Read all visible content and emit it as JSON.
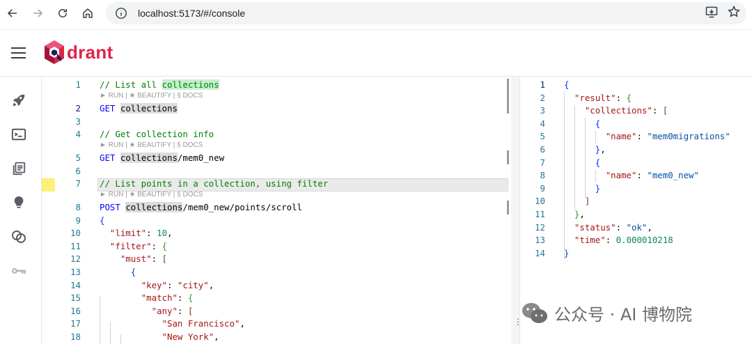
{
  "browser": {
    "url": "localhost:5173/#/console"
  },
  "app": {
    "logo_text": "drant"
  },
  "sidebar": {
    "items": [
      {
        "icon": "rocket-icon"
      },
      {
        "icon": "console-icon"
      },
      {
        "icon": "collections-icon"
      },
      {
        "icon": "lightbulb-icon"
      },
      {
        "icon": "integrations-icon"
      },
      {
        "icon": "key-icon"
      }
    ]
  },
  "editor": {
    "lens_text": "► RUN | ★ BEAUTIFY | § DOCS",
    "lines": [
      {
        "n": "1"
      },
      {
        "n": "2"
      },
      {
        "n": "3"
      },
      {
        "n": "4"
      },
      {
        "n": "5"
      },
      {
        "n": "6"
      },
      {
        "n": "7"
      },
      {
        "n": "8"
      },
      {
        "n": "9"
      },
      {
        "n": "10"
      },
      {
        "n": "11"
      },
      {
        "n": "12"
      },
      {
        "n": "13"
      },
      {
        "n": "14"
      },
      {
        "n": "15"
      },
      {
        "n": "16"
      },
      {
        "n": "17"
      },
      {
        "n": "18"
      }
    ],
    "code": {
      "l1_comment": "// List all ",
      "l1_hl": "collections",
      "l2_method": "GET",
      "l2_path": "collections",
      "l4_comment": "// Get collection info",
      "l5_method": "GET",
      "l5_hl": "collections",
      "l5_rest": "/mem0_new",
      "l7_comment": "// List points in a collection, using filter",
      "l8_method": "POST",
      "l8_hl": "collections",
      "l8_rest": "/mem0_new/points/scroll",
      "l9": "{",
      "l10_key": "\"limit\"",
      "l10_val": "10",
      "l11_key": "\"filter\"",
      "l11_br": "{",
      "l12_key": "\"must\"",
      "l12_br": "[",
      "l13_br": "{",
      "l14_key": "\"key\"",
      "l14_val": "\"city\"",
      "l15_key": "\"match\"",
      "l15_br": "{",
      "l16_key": "\"any\"",
      "l16_br": "[",
      "l17_val": "\"San Francisco\"",
      "l18_val": "\"New York\""
    }
  },
  "result": {
    "lines": [
      {
        "n": "1"
      },
      {
        "n": "2"
      },
      {
        "n": "3"
      },
      {
        "n": "4"
      },
      {
        "n": "5"
      },
      {
        "n": "6"
      },
      {
        "n": "7"
      },
      {
        "n": "8"
      },
      {
        "n": "9"
      },
      {
        "n": "10"
      },
      {
        "n": "11"
      },
      {
        "n": "12"
      },
      {
        "n": "13"
      },
      {
        "n": "14"
      }
    ],
    "json": {
      "result_key": "\"result\"",
      "collections_key": "\"collections\"",
      "name_key": "\"name\"",
      "name1": "\"mem0migrations\"",
      "name2": "\"mem0_new\"",
      "status_key": "\"status\"",
      "status_val": "\"ok\"",
      "time_key": "\"time\"",
      "time_val": "0.000010218"
    }
  },
  "watermark": {
    "text": "公众号 · AI 博物院"
  }
}
